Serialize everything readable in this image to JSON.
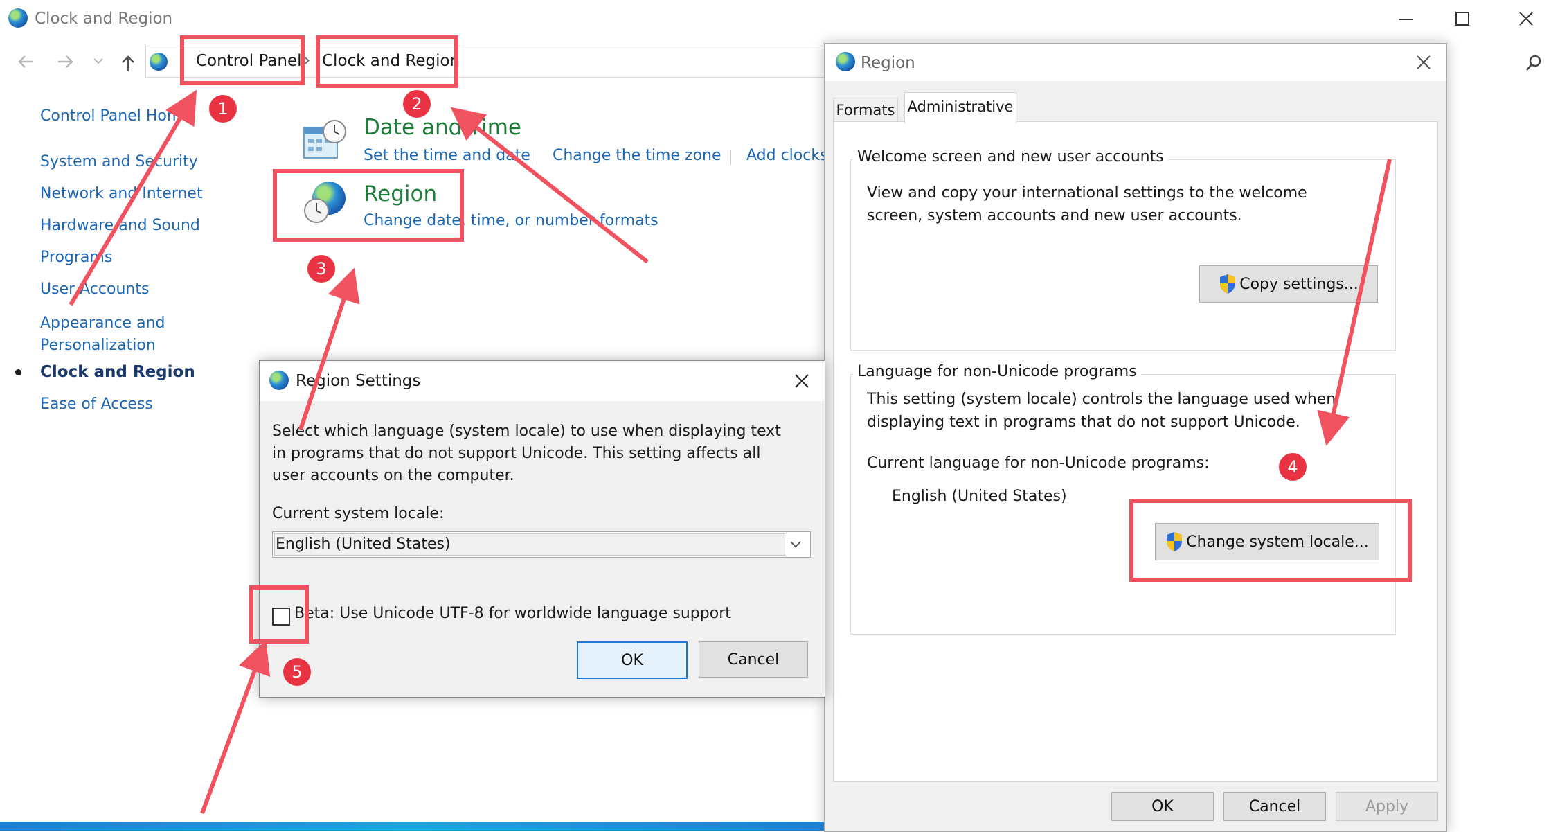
{
  "window": {
    "title": "Clock and Region"
  },
  "address_bar": {
    "crumbs": [
      "Control Panel",
      "Clock and Region"
    ],
    "separator": "›"
  },
  "sidebar": {
    "items": [
      {
        "label": "Control Panel Home",
        "active": false
      },
      {
        "label": "System and Security",
        "active": false
      },
      {
        "label": "Network and Internet",
        "active": false
      },
      {
        "label": "Hardware and Sound",
        "active": false
      },
      {
        "label": "Programs",
        "active": false
      },
      {
        "label": "User Accounts",
        "active": false
      },
      {
        "label": "Appearance and Personalization",
        "active": false
      },
      {
        "label": "Clock and Region",
        "active": true
      },
      {
        "label": "Ease of Access",
        "active": false
      }
    ]
  },
  "content": {
    "date_time": {
      "title": "Date and Time",
      "links": [
        "Set the time and date",
        "Change the time zone",
        "Add clocks"
      ]
    },
    "region": {
      "title": "Region",
      "link": "Change date, time, or number formats"
    }
  },
  "region_dialog": {
    "title": "Region",
    "tabs": [
      "Formats",
      "Administrative"
    ],
    "active_tab": "Administrative",
    "welcome_group": {
      "title": "Welcome screen and new user accounts",
      "text": "View and copy your international settings to the welcome screen, system accounts and new user accounts.",
      "button": "Copy settings..."
    },
    "non_unicode_group": {
      "title": "Language for non-Unicode programs",
      "text": "This setting (system locale) controls the language used when displaying text in programs that do not support Unicode.",
      "current_label": "Current language for non-Unicode programs:",
      "current_value": "English (United States)",
      "button": "Change system locale..."
    },
    "buttons": {
      "ok": "OK",
      "cancel": "Cancel",
      "apply": "Apply"
    }
  },
  "region_settings": {
    "title": "Region Settings",
    "description": "Select which language (system locale) to use when displaying text in programs that do not support Unicode. This setting affects all user accounts on the computer.",
    "locale_label": "Current system locale:",
    "locale_value": "English (United States)",
    "beta_label": "Beta: Use Unicode UTF-8 for worldwide language support",
    "beta_checked": false,
    "buttons": {
      "ok": "OK",
      "cancel": "Cancel"
    }
  },
  "annotations": {
    "badges": [
      "1",
      "2",
      "3",
      "4",
      "5"
    ],
    "color": "#f0525f"
  },
  "colors": {
    "link": "#1c67b3",
    "heading_green": "#1e7d3a",
    "accent_blue": "#1f78d1"
  }
}
